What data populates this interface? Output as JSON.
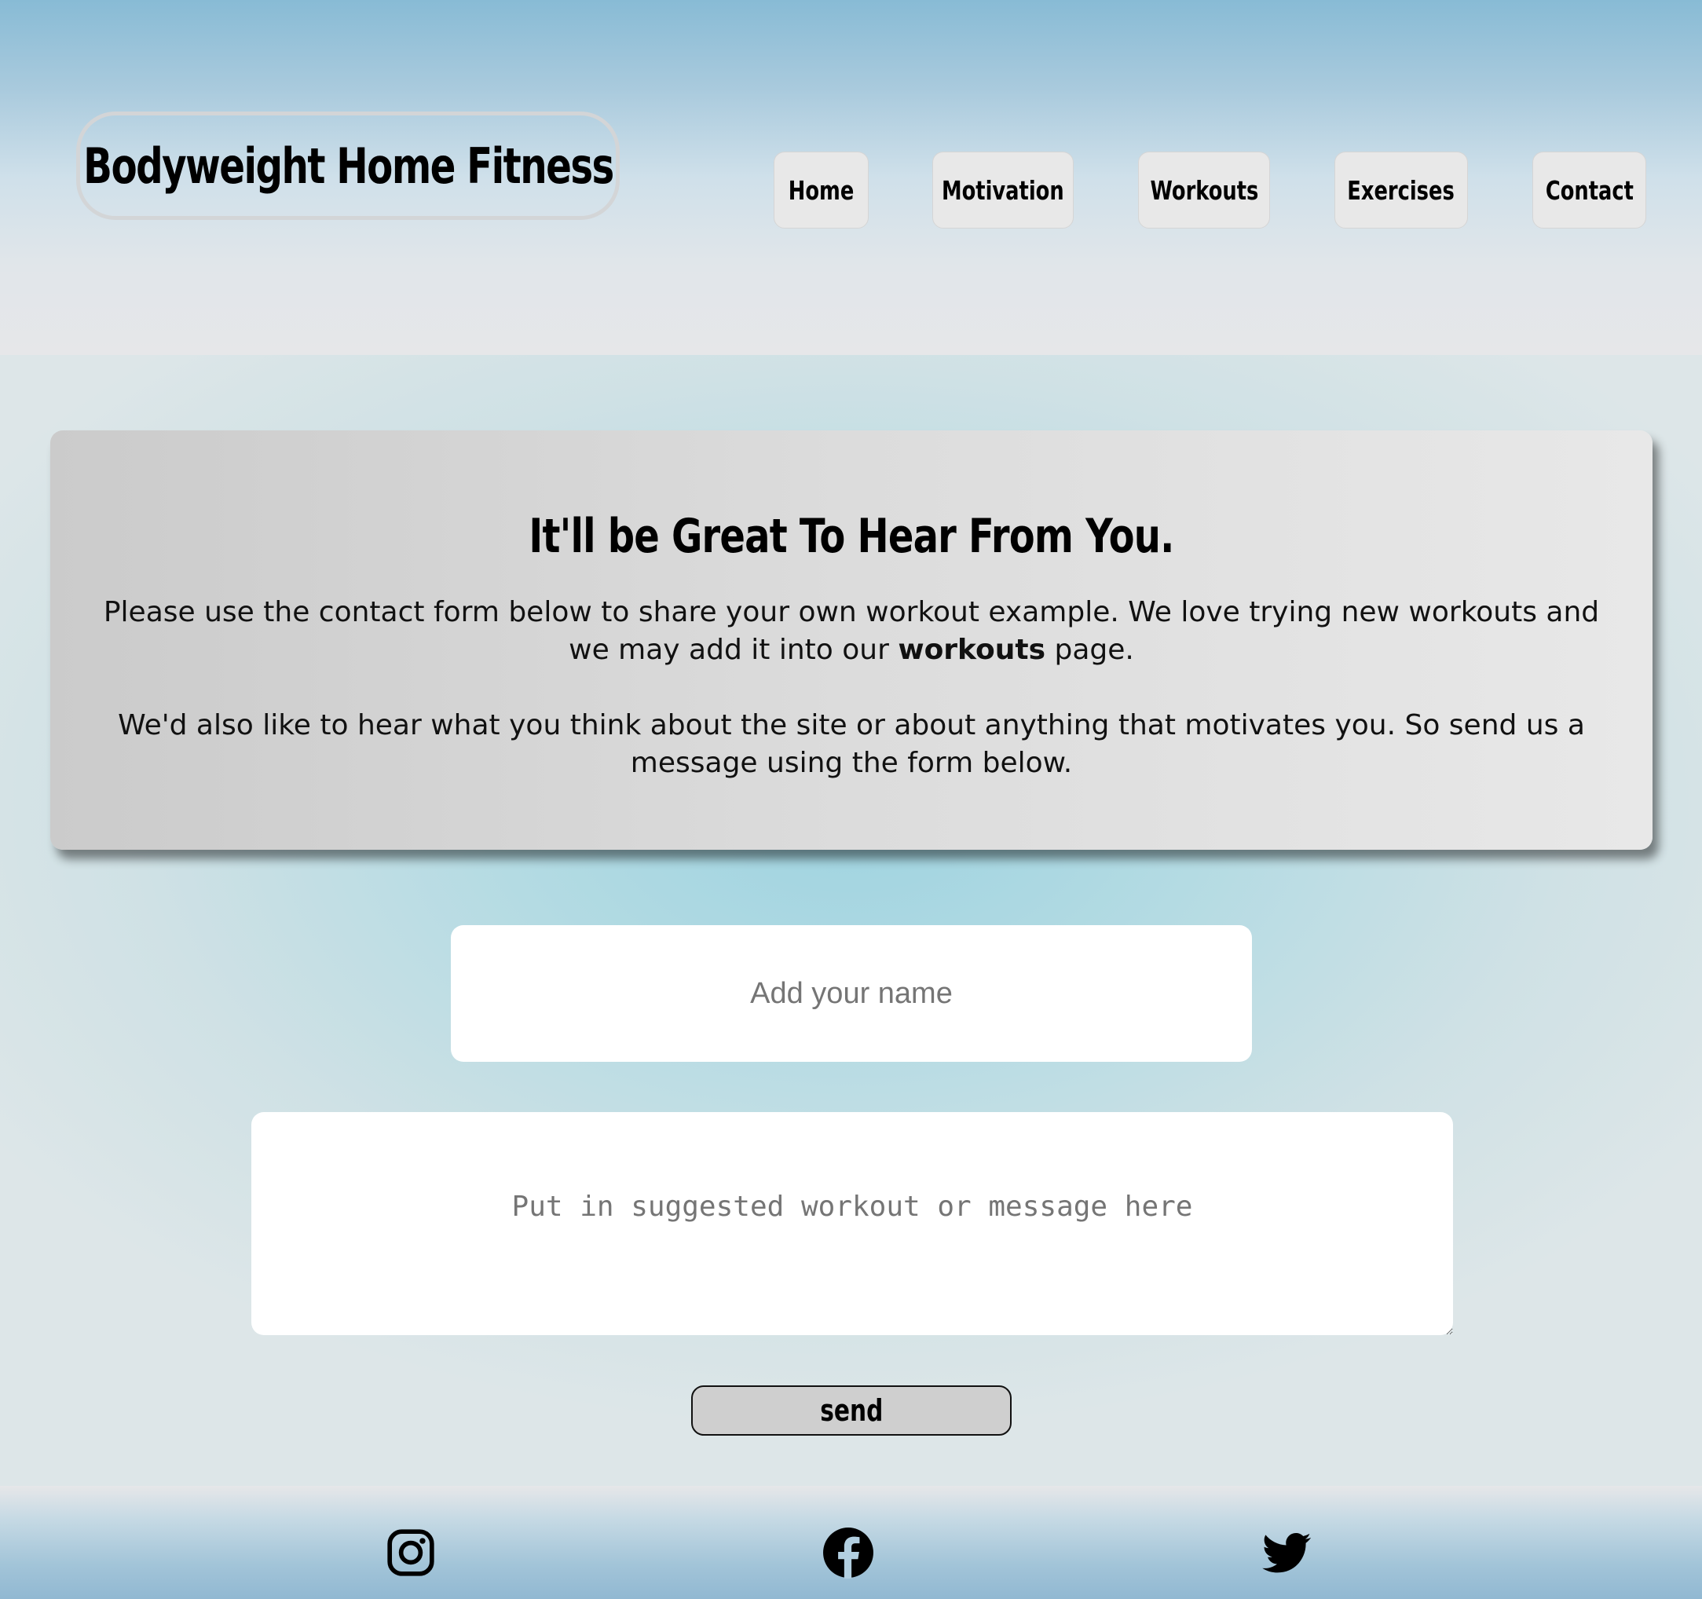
{
  "header": {
    "logo": "Bodyweight Home Fitness",
    "nav": [
      {
        "label": "Home"
      },
      {
        "label": "Motivation"
      },
      {
        "label": "Workouts"
      },
      {
        "label": "Exercises"
      },
      {
        "label": "Contact"
      }
    ]
  },
  "intro": {
    "title": "It'll be Great To Hear From You.",
    "para1_before": "Please use the contact form below to share your own workout example. We love trying new workouts and we may add it into our ",
    "para1_bold": "workouts",
    "para1_after": " page.",
    "para2": "We'd also like to hear what you think about the site or about anything that motivates you. So send us a message using the form below."
  },
  "form": {
    "name_placeholder": "Add your name",
    "message_placeholder": "Put in suggested workout or message here",
    "send_label": "send"
  },
  "footer": {
    "icons": [
      "instagram-icon",
      "facebook-icon",
      "twitter-icon"
    ]
  }
}
